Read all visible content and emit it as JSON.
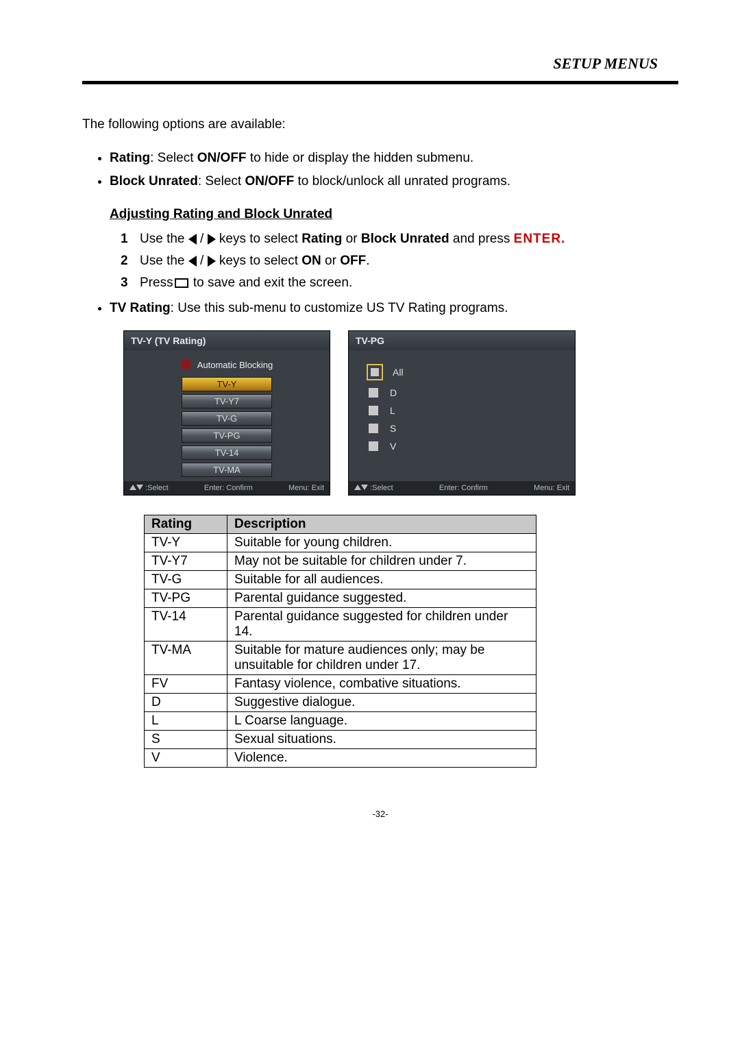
{
  "header": {
    "title": "SETUP MENUS"
  },
  "intro": "The following options are available:",
  "bullets": {
    "rating": {
      "bold": "Rating",
      "rest": ": Select ",
      "onoff": "ON/OFF",
      "rest2": " to hide or display the hidden submenu."
    },
    "block": {
      "bold": "Block Unrated",
      "rest": ": Select ",
      "onoff": "ON/OFF",
      "rest2": " to block/unlock all unrated programs."
    },
    "tvrating": {
      "bold": "TV Rating",
      "rest": ": Use this sub-menu to customize US TV Rating programs."
    }
  },
  "subheading": "Adjusting Rating and Block Unrated",
  "steps": {
    "1": {
      "pre": "Use the ",
      "mid": " keys to select ",
      "b1": "Rating",
      "or": " or ",
      "b2": "Block Unrated",
      "and": " and press ",
      "enter": "ENTER."
    },
    "2": {
      "pre": "Use the ",
      "mid": " keys to select ",
      "on": "ON",
      "or2": " or ",
      "off": "OFF",
      "dot": "."
    },
    "3": {
      "pre": "Press",
      "post": " to save and exit the screen."
    }
  },
  "osd": {
    "left": {
      "title": "TV-Y (TV Rating)",
      "auto": "Automatic Blocking",
      "items": [
        "TV-Y",
        "TV-Y7",
        "TV-G",
        "TV-PG",
        "TV-14",
        "TV-MA"
      ]
    },
    "right": {
      "title": "TV-PG",
      "items": [
        "All",
        "D",
        "L",
        "S",
        "V"
      ]
    },
    "footer": {
      "sel": ":Select",
      "ent": "Enter: Confirm",
      "menu": "Menu: Exit"
    }
  },
  "table": {
    "head": {
      "rating": "Rating",
      "desc": "Description"
    },
    "rows": [
      {
        "r": "TV-Y",
        "d": "Suitable for young children."
      },
      {
        "r": "TV-Y7",
        "d": "May not be suitable for children under 7."
      },
      {
        "r": "TV-G",
        "d": "Suitable for all audiences."
      },
      {
        "r": "TV-PG",
        "d": "Parental guidance suggested."
      },
      {
        "r": "TV-14",
        "d": "Parental guidance suggested for children under 14."
      },
      {
        "r": "TV-MA",
        "d": "Suitable for mature audiences only; may be unsuitable for children under 17."
      },
      {
        "r": "FV",
        "d": "Fantasy violence, combative situations."
      },
      {
        "r": "D",
        "d": "Suggestive dialogue."
      },
      {
        "r": "L",
        "d": "L Coarse language."
      },
      {
        "r": "S",
        "d": "Sexual situations."
      },
      {
        "r": "V",
        "d": "Violence."
      }
    ]
  },
  "page": "-32-"
}
